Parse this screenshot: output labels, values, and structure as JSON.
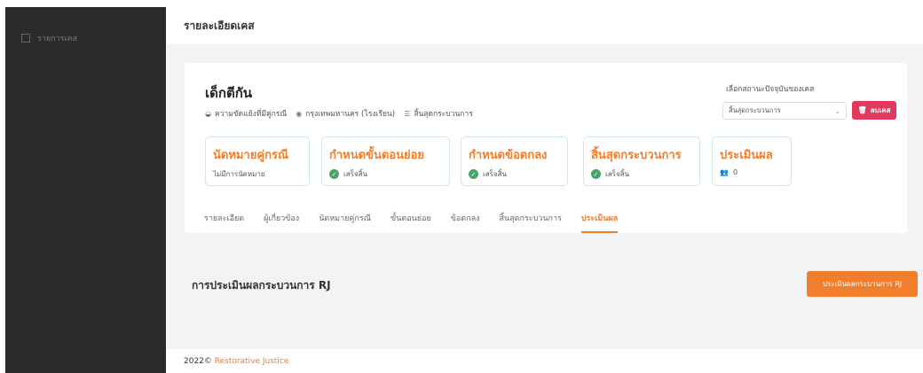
{
  "sidebar": {
    "items": [
      {
        "label": "รายการเคส",
        "icon": "list-icon"
      }
    ]
  },
  "header": {
    "title": "รายละเอียดเคส"
  },
  "case": {
    "title": "เด็กตีกัน",
    "meta": [
      {
        "icon": "conflict-icon",
        "text": "ความขัดแย้งที่มีคู่กรณี"
      },
      {
        "icon": "location-icon",
        "text": "กรุงเทพมหานคร (โรงเรียน)"
      },
      {
        "icon": "list-icon",
        "text": "สิ้นสุดกระบวนการ"
      }
    ]
  },
  "status": {
    "label": "เลือกสถานะปัจจุบันของเคส",
    "selected": "สิ้นสุดกระบวนการ",
    "delete_label": "ลบเคส"
  },
  "steps": [
    {
      "title": "นัดหมายคู่กรณี",
      "sub": "ไม่มีการนัดหมาย"
    },
    {
      "title": "กำหนดขั้นตอนย่อย",
      "sub": "เสร็จสิ้น"
    },
    {
      "title": "กำหนดข้อตกลง",
      "sub": "เสร็จสิ้น"
    },
    {
      "title": "สิ้นสุดกระบวนการ",
      "sub": "เสร็จสิ้น"
    },
    {
      "title": "ประเมินผล",
      "sub": "0"
    }
  ],
  "tabs": [
    {
      "label": "รายละเอียด"
    },
    {
      "label": "ผู้เกี่ยวข้อง"
    },
    {
      "label": "นัดหมายคู่กรณี"
    },
    {
      "label": "ขั้นตอนย่อย"
    },
    {
      "label": "ข้อตกลง"
    },
    {
      "label": "สิ้นสุดกระบวนการ"
    },
    {
      "label": "ประเมินผล",
      "active": true
    }
  ],
  "evaluation": {
    "title": "การประเมินผลกระบวนการ RJ",
    "button_label": "ประเมินผลกระบวนการ RJ"
  },
  "footer": {
    "year": "2022©",
    "brand": "Restorative Justice"
  },
  "colors": {
    "accent": "#f07e2c",
    "danger": "#e23a5c",
    "success": "#49a36b",
    "sidebar": "#2b2b2b"
  }
}
